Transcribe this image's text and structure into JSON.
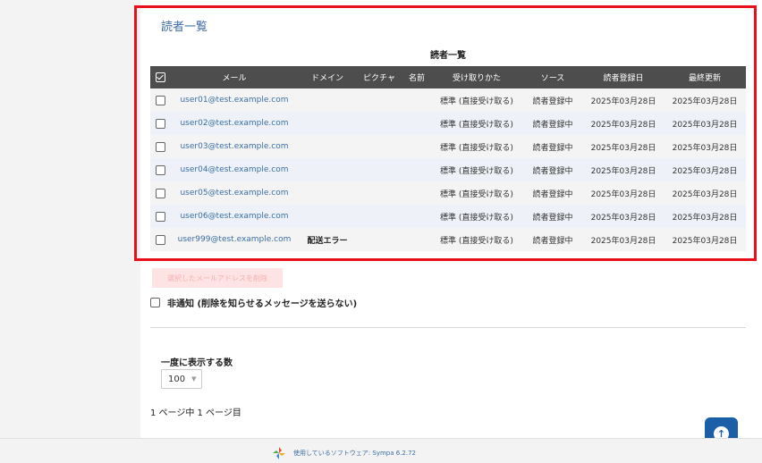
{
  "page_title": "読者一覧",
  "table": {
    "caption": "読者一覧",
    "headers": [
      "メール",
      "ドメイン",
      "ピクチャ",
      "名前",
      "受け取りかた",
      "ソース",
      "読者登録日",
      "最終更新"
    ],
    "rows": [
      {
        "email": "user01@test.example.com",
        "domain": "",
        "picture": "",
        "name": "",
        "reception": "標準 (直接受け取る)",
        "source": "読者登録中",
        "subscribed": "2025年03月28日",
        "updated": "2025年03月28日"
      },
      {
        "email": "user02@test.example.com",
        "domain": "",
        "picture": "",
        "name": "",
        "reception": "標準 (直接受け取る)",
        "source": "読者登録中",
        "subscribed": "2025年03月28日",
        "updated": "2025年03月28日"
      },
      {
        "email": "user03@test.example.com",
        "domain": "",
        "picture": "",
        "name": "",
        "reception": "標準 (直接受け取る)",
        "source": "読者登録中",
        "subscribed": "2025年03月28日",
        "updated": "2025年03月28日"
      },
      {
        "email": "user04@test.example.com",
        "domain": "",
        "picture": "",
        "name": "",
        "reception": "標準 (直接受け取る)",
        "source": "読者登録中",
        "subscribed": "2025年03月28日",
        "updated": "2025年03月28日"
      },
      {
        "email": "user05@test.example.com",
        "domain": "",
        "picture": "",
        "name": "",
        "reception": "標準 (直接受け取る)",
        "source": "読者登録中",
        "subscribed": "2025年03月28日",
        "updated": "2025年03月28日"
      },
      {
        "email": "user06@test.example.com",
        "domain": "",
        "picture": "",
        "name": "",
        "reception": "標準 (直接受け取る)",
        "source": "読者登録中",
        "subscribed": "2025年03月28日",
        "updated": "2025年03月28日"
      },
      {
        "email": "user999@test.example.com",
        "domain": "配送エラー",
        "picture": "",
        "name": "",
        "reception": "標準 (直接受け取る)",
        "source": "読者登録中",
        "subscribed": "2025年03月28日",
        "updated": "2025年03月28日"
      }
    ]
  },
  "delete_button_label": "選択したメールアドレスを削除",
  "quiet_option_label": "非通知 (削除を知らせるメッセージを送らない)",
  "per_page": {
    "label": "一度に表示する数",
    "value": "100"
  },
  "page_info": "1 ページ中 1 ページ目",
  "footer_text": "使用しているソフトウェア: Sympa 6.2.72",
  "colors": {
    "highlight_border": "#e8101a",
    "header_bg": "#4d4d4d",
    "link": "#3b6fa7",
    "scroll_button": "#1a5fa8"
  }
}
